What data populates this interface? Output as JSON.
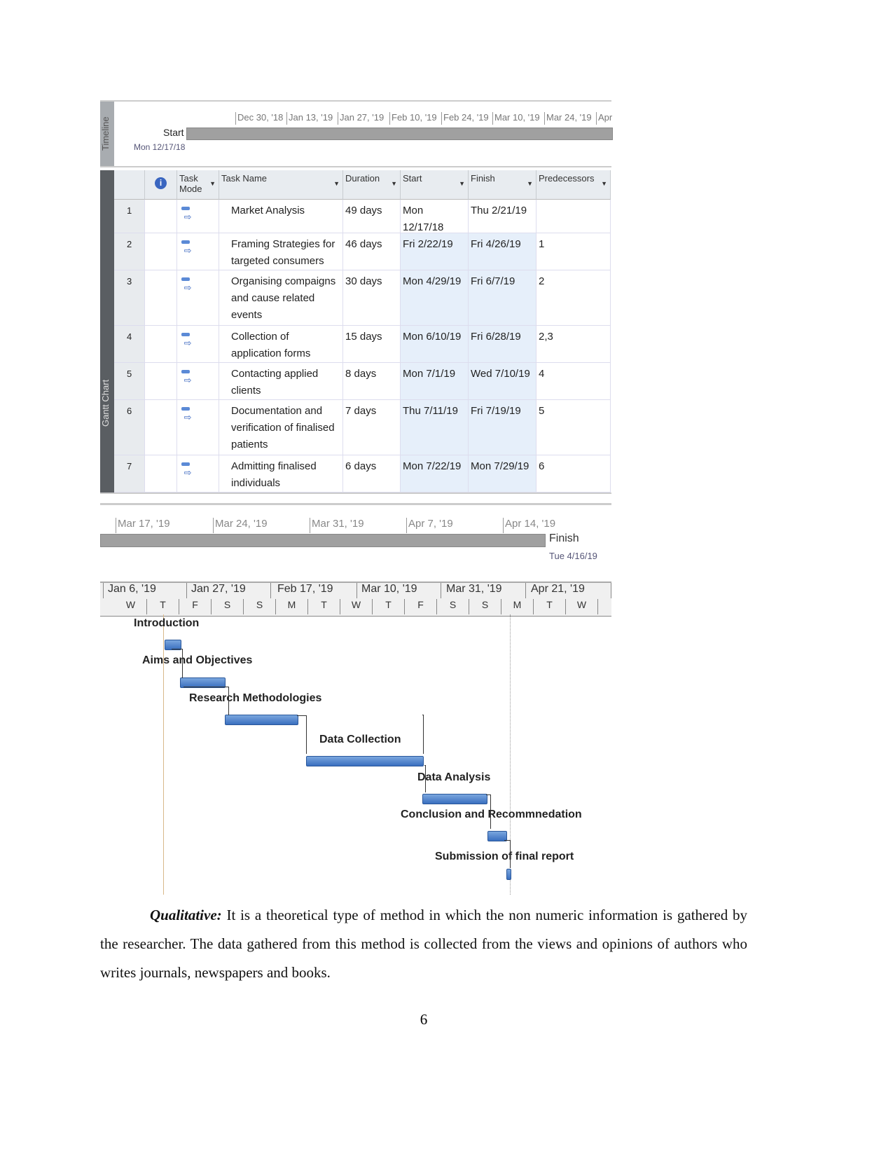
{
  "timeline_top": {
    "label": "Timeline",
    "start_label": "Start",
    "start_date": "Mon 12/17/18",
    "ticks": [
      "Dec 30, '18",
      "Jan 13, '19",
      "Jan 27, '19",
      "Feb 10, '19",
      "Feb 24, '19",
      "Mar 10, '19",
      "Mar 24, '19",
      "Apr"
    ]
  },
  "table": {
    "side_label": "Gantt Chart",
    "columns": [
      "Task Mode",
      "Task Name",
      "Duration",
      "Start",
      "Finish",
      "Predecessors"
    ],
    "rows": [
      {
        "id": "1",
        "name": "Market Analysis",
        "duration": "49 days",
        "start": "Mon 12/17/18",
        "finish": "Thu 2/21/19",
        "pred": ""
      },
      {
        "id": "2",
        "name": "Framing Strategies for targeted consumers",
        "duration": "46 days",
        "start": "Fri 2/22/19",
        "finish": "Fri 4/26/19",
        "pred": "1"
      },
      {
        "id": "3",
        "name": "Organising compaigns and cause related events",
        "duration": "30 days",
        "start": "Mon 4/29/19",
        "finish": "Fri 6/7/19",
        "pred": "2"
      },
      {
        "id": "4",
        "name": "Collection of application forms",
        "duration": "15 days",
        "start": "Mon 6/10/19",
        "finish": "Fri 6/28/19",
        "pred": "2,3"
      },
      {
        "id": "5",
        "name": "Contacting applied clients",
        "duration": "8 days",
        "start": "Mon 7/1/19",
        "finish": "Wed 7/10/19",
        "pred": "4"
      },
      {
        "id": "6",
        "name": "Documentation and verification of finalised patients",
        "duration": "7 days",
        "start": "Thu 7/11/19",
        "finish": "Fri 7/19/19",
        "pred": "5"
      },
      {
        "id": "7",
        "name": "Admitting finalised individuals",
        "duration": "6 days",
        "start": "Mon 7/22/19",
        "finish": "Mon 7/29/19",
        "pred": "6"
      }
    ]
  },
  "timeline_bottom": {
    "ticks": [
      "Mar 17, '19",
      "Mar 24, '19",
      "Mar 31, '19",
      "Apr 7, '19",
      "Apr 14, '19"
    ],
    "finish_label": "Finish",
    "finish_date": "Tue 4/16/19"
  },
  "gantt": {
    "weeks": [
      "Jan 6, '19",
      "Jan 27, '19",
      "Feb 17, '19",
      "Mar 10, '19",
      "Mar 31, '19",
      "Apr 21, '19"
    ],
    "days": [
      "W",
      "T",
      "F",
      "S",
      "S",
      "M",
      "T",
      "W",
      "T",
      "F",
      "S",
      "S",
      "M",
      "T",
      "W"
    ],
    "tasks": [
      "Introduction",
      "Aims and Objectives",
      "Research Methodologies",
      "Data Collection",
      "Data Analysis",
      "Conclusion and Recommnedation",
      "Submission of final report"
    ]
  },
  "body": {
    "bold_term": "Qualitative:",
    "text": " It is a theoretical type of method in which the non numeric information is gathered by the researcher. The data gathered from this method is collected from the views and opinions of authors who writes journals, newspapers and books."
  },
  "page_number": "6"
}
